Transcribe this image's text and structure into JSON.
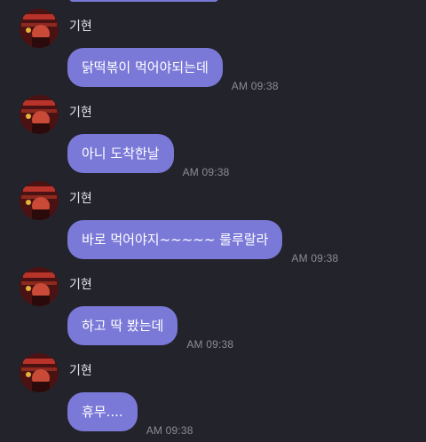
{
  "messages": [
    {
      "sender": "기현",
      "text": "닭떡볶이 먹어야되는데",
      "time": "AM 09:38"
    },
    {
      "sender": "기현",
      "text": "아니 도착한날",
      "time": "AM 09:38"
    },
    {
      "sender": "기현",
      "text": "바로 먹어야지~~~~~ 룰루랄라",
      "time": "AM 09:38"
    },
    {
      "sender": "기현",
      "text": "하고 딱 봤는데",
      "time": "AM 09:38"
    },
    {
      "sender": "기현",
      "text": "휴무....",
      "time": "AM 09:38"
    }
  ],
  "colors": {
    "background": "#23232b",
    "bubble": "#7b79d8",
    "bubble_text": "#ffffff",
    "sender_text": "#e6e6ee",
    "time_text": "#8c8c97"
  },
  "icons": {
    "avatar": "profile-photo"
  }
}
